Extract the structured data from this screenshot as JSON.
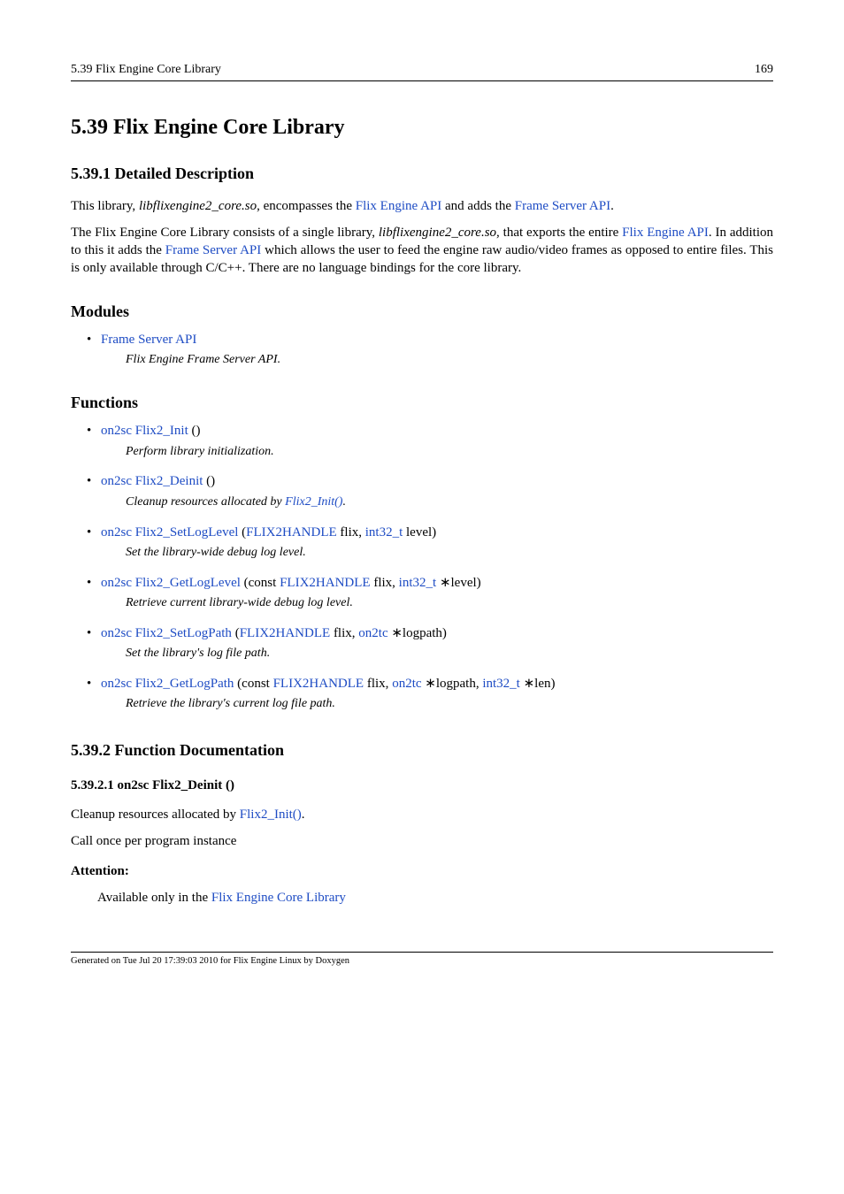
{
  "header": {
    "left": "5.39 Flix Engine Core Library",
    "right": "169"
  },
  "section": {
    "number_title": "5.39   Flix Engine Core Library"
  },
  "detailed": {
    "heading": "5.39.1   Detailed Description",
    "p1_a": "This library, ",
    "p1_lib": "libflixengine2_core.so",
    "p1_b": ", encompasses the ",
    "p1_link1": "Flix Engine API",
    "p1_c": " and adds the ",
    "p1_link2": "Frame Server API",
    "p1_d": ".",
    "p2_a": "The Flix Engine Core Library consists of a single library, ",
    "p2_lib": "libflixengine2_core.so",
    "p2_b": ", that exports the entire ",
    "p2_link1": "Flix Engine API",
    "p2_c": ". In addition to this it adds the ",
    "p2_link2": "Frame Server API",
    "p2_d": " which allows the user to feed the engine raw audio/video frames as opposed to entire files. This is only available through C/C++. There are no language bindings for the core library."
  },
  "modules": {
    "heading": "Modules",
    "items": [
      {
        "link": "Frame Server API",
        "desc": "Flix Engine Frame Server API."
      }
    ]
  },
  "functions": {
    "heading": "Functions",
    "items": [
      {
        "sig_parts": [
          {
            "t": "link",
            "v": "on2sc"
          },
          {
            "t": "text",
            "v": " "
          },
          {
            "t": "link",
            "v": "Flix2_Init"
          },
          {
            "t": "text",
            "v": " ()"
          }
        ],
        "desc": "Perform library initialization."
      },
      {
        "sig_parts": [
          {
            "t": "link",
            "v": "on2sc"
          },
          {
            "t": "text",
            "v": " "
          },
          {
            "t": "link",
            "v": "Flix2_Deinit"
          },
          {
            "t": "text",
            "v": " ()"
          }
        ],
        "desc_parts": [
          {
            "t": "text",
            "v": "Cleanup resources allocated by "
          },
          {
            "t": "link",
            "v": "Flix2_Init()"
          },
          {
            "t": "text",
            "v": "."
          }
        ]
      },
      {
        "sig_parts": [
          {
            "t": "link",
            "v": "on2sc"
          },
          {
            "t": "text",
            "v": " "
          },
          {
            "t": "link",
            "v": "Flix2_SetLogLevel"
          },
          {
            "t": "text",
            "v": " ("
          },
          {
            "t": "link",
            "v": "FLIX2HANDLE"
          },
          {
            "t": "text",
            "v": " flix, "
          },
          {
            "t": "link",
            "v": "int32_t"
          },
          {
            "t": "text",
            "v": " level)"
          }
        ],
        "desc": "Set the library-wide debug log level."
      },
      {
        "sig_parts": [
          {
            "t": "link",
            "v": "on2sc"
          },
          {
            "t": "text",
            "v": " "
          },
          {
            "t": "link",
            "v": "Flix2_GetLogLevel"
          },
          {
            "t": "text",
            "v": " (const "
          },
          {
            "t": "link",
            "v": "FLIX2HANDLE"
          },
          {
            "t": "text",
            "v": " flix, "
          },
          {
            "t": "link",
            "v": "int32_t"
          },
          {
            "t": "text",
            "v": " ∗level)"
          }
        ],
        "desc": "Retrieve current library-wide debug log level."
      },
      {
        "sig_parts": [
          {
            "t": "link",
            "v": "on2sc"
          },
          {
            "t": "text",
            "v": " "
          },
          {
            "t": "link",
            "v": "Flix2_SetLogPath"
          },
          {
            "t": "text",
            "v": " ("
          },
          {
            "t": "link",
            "v": "FLIX2HANDLE"
          },
          {
            "t": "text",
            "v": " flix, "
          },
          {
            "t": "link",
            "v": "on2tc"
          },
          {
            "t": "text",
            "v": " ∗logpath)"
          }
        ],
        "desc": "Set the library's log file path."
      },
      {
        "sig_parts": [
          {
            "t": "link",
            "v": "on2sc"
          },
          {
            "t": "text",
            "v": " "
          },
          {
            "t": "link",
            "v": "Flix2_GetLogPath"
          },
          {
            "t": "text",
            "v": " (const "
          },
          {
            "t": "link",
            "v": "FLIX2HANDLE"
          },
          {
            "t": "text",
            "v": " flix, "
          },
          {
            "t": "link",
            "v": "on2tc"
          },
          {
            "t": "text",
            "v": " ∗logpath, "
          },
          {
            "t": "link",
            "v": "int32_t"
          },
          {
            "t": "text",
            "v": " ∗len)"
          }
        ],
        "desc": "Retrieve the library's current log file path."
      }
    ]
  },
  "funcdoc": {
    "heading": "5.39.2   Function Documentation",
    "item_heading": "5.39.2.1   on2sc Flix2_Deinit ()",
    "p1_a": "Cleanup resources allocated by ",
    "p1_link": "Flix2_Init()",
    "p1_b": ".",
    "p2": "Call once per program instance",
    "attention_label": "Attention:",
    "attention_a": "Available only in the ",
    "attention_link": "Flix Engine Core Library"
  },
  "footer": "Generated on Tue Jul 20 17:39:03 2010 for Flix Engine Linux by Doxygen"
}
